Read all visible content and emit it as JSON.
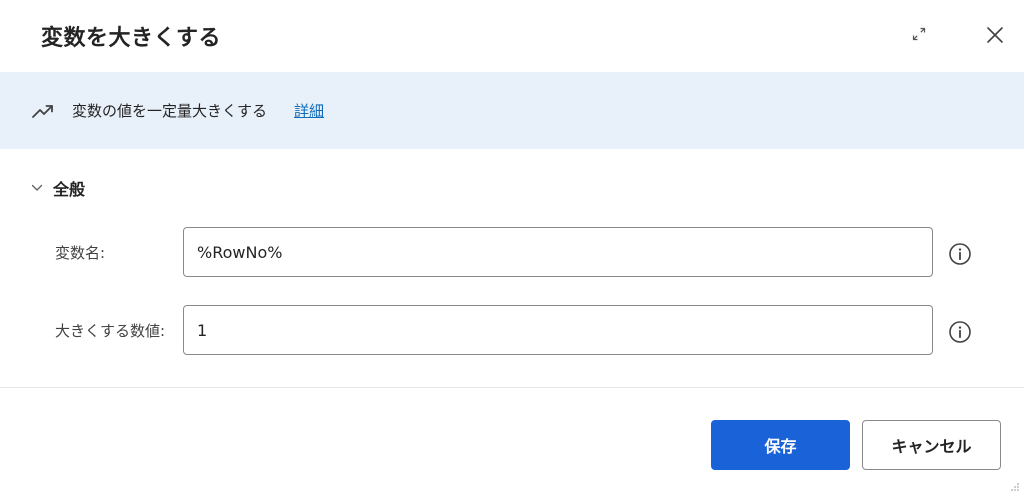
{
  "dialog": {
    "title": "変数を大きくする"
  },
  "header": {
    "expand_icon": "expand-arrows-icon",
    "close_icon": "close-icon"
  },
  "banner": {
    "icon": "trending-up-icon",
    "text": "変数の値を一定量大きくする",
    "link": "詳細"
  },
  "section": {
    "title": "全般",
    "chevron_icon": "chevron-down-icon"
  },
  "fields": [
    {
      "label": "変数名:",
      "value": "%RowNo%"
    },
    {
      "label": "大きくする数値:",
      "value": "1"
    }
  ],
  "footer": {
    "save_label": "保存",
    "cancel_label": "キャンセル"
  },
  "colors": {
    "accent": "#1a62d8",
    "banner_bg": "#e8f0f9",
    "link": "#0f6cbd"
  }
}
